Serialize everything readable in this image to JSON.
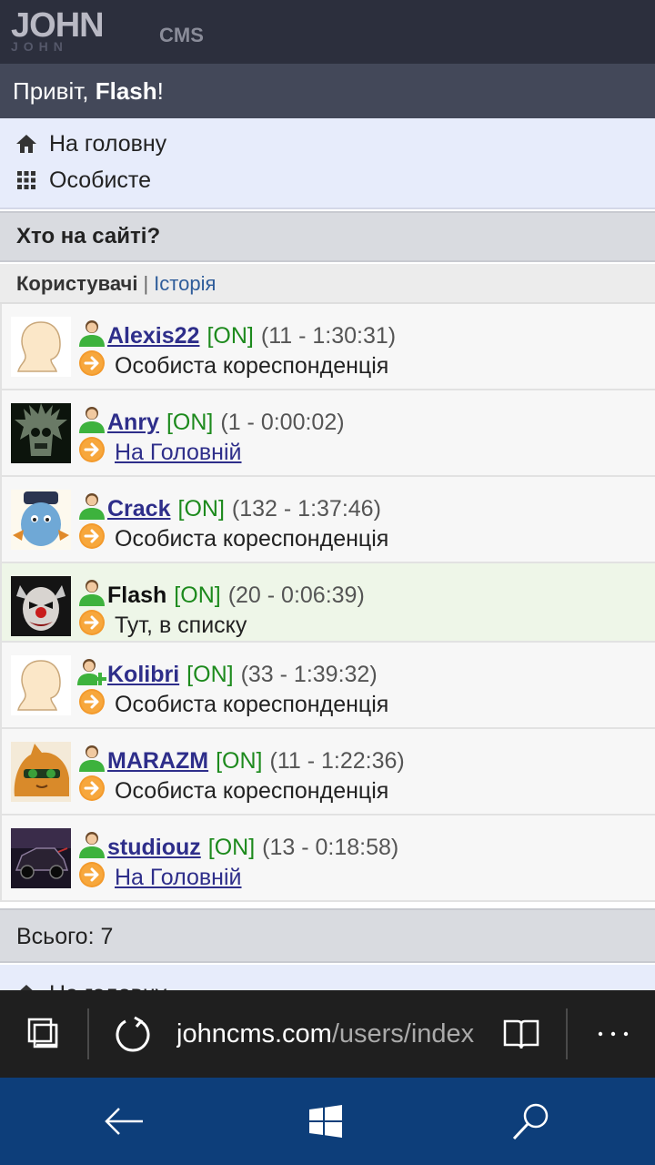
{
  "logo": {
    "main": "JOHN",
    "sub": "CMS"
  },
  "greeting": {
    "prefix": "Привіт, ",
    "user": "Flash",
    "suffix": "!"
  },
  "nav": {
    "home": "На головну",
    "personal": "Особисте"
  },
  "section": {
    "title": "Хто на сайті?",
    "tab_current": "Користувачі",
    "separator": "|",
    "tab_link": "Історія"
  },
  "users": [
    {
      "name": "Alexis22",
      "status": "[ON]",
      "meta": "(11 - 1:30:31)",
      "place": "Особиста кореспонденція",
      "place_link": false,
      "avatar": "default-avatar",
      "icon": "user-icon"
    },
    {
      "name": "Anry",
      "status": "[ON]",
      "meta": "(1 - 0:00:02)",
      "place": "На Головній",
      "place_link": true,
      "avatar": "skull-avatar",
      "icon": "user-icon"
    },
    {
      "name": "Crack",
      "status": "[ON]",
      "meta": "(132 - 1:37:46)",
      "place": "Особиста кореспонденція",
      "place_link": false,
      "avatar": "blue-toy-avatar",
      "icon": "user-icon"
    },
    {
      "name": "Flash",
      "status": "[ON]",
      "meta": "(20 - 0:06:39)",
      "place": "Тут, в списку",
      "place_link": false,
      "avatar": "clown-avatar",
      "icon": "user-icon",
      "current": true
    },
    {
      "name": "Kolibri",
      "status": "[ON]",
      "meta": "(33 - 1:39:32)",
      "place": "Особиста кореспонденція",
      "place_link": false,
      "avatar": "default-avatar",
      "icon": "user-plus-icon"
    },
    {
      "name": "MARAZM",
      "status": "[ON]",
      "meta": "(11 - 1:22:36)",
      "place": "Особиста кореспонденція",
      "place_link": false,
      "avatar": "cat-avatar",
      "icon": "user-icon"
    },
    {
      "name": "studiouz",
      "status": "[ON]",
      "meta": "(13 - 0:18:58)",
      "place": "На Головній",
      "place_link": true,
      "avatar": "car-avatar",
      "icon": "user-icon"
    }
  ],
  "total": "Всього: 7",
  "footer_nav": {
    "home": "На головну"
  },
  "browser": {
    "url_host": "johncms.com",
    "url_path": "/users/index"
  },
  "colors": {
    "online": "#1d8a1d",
    "link": "#2e2e8a",
    "header_bg": "#2c2f3d",
    "nav_bg": "#e7ecfb",
    "system_nav": "#0d3e7a"
  }
}
